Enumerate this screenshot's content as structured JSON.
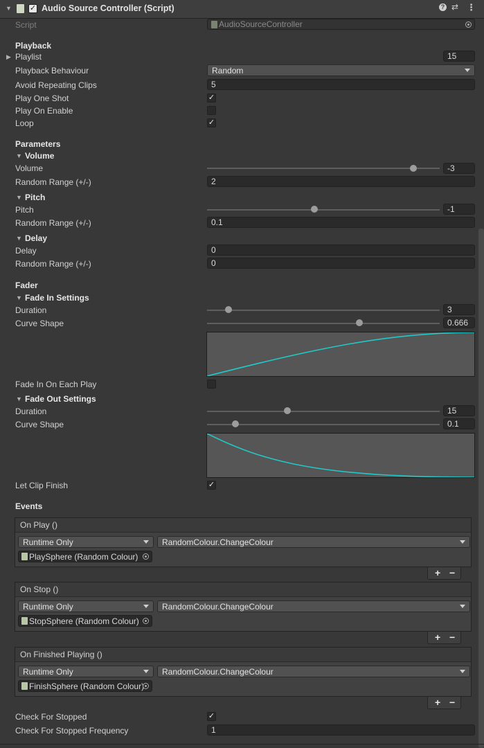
{
  "header": {
    "title": "Audio Source Controller (Script)"
  },
  "script": {
    "label": "Script",
    "value": "AudioSourceController"
  },
  "playback": {
    "section": "Playback",
    "playlist_label": "Playlist",
    "playlist_count": "15",
    "behaviour_label": "Playback Behaviour",
    "behaviour_value": "Random",
    "avoid_label": "Avoid Repeating Clips",
    "avoid_value": "5",
    "one_shot_label": "Play One Shot",
    "one_shot": true,
    "on_enable_label": "Play On Enable",
    "on_enable": false,
    "loop_label": "Loop",
    "loop": true
  },
  "parameters": {
    "section": "Parameters",
    "volume": {
      "group": "Volume",
      "label": "Volume",
      "value": "-3",
      "slider": 0.9,
      "range_label": "Random Range (+/-)",
      "range_value": "2"
    },
    "pitch": {
      "group": "Pitch",
      "label": "Pitch",
      "value": "-1",
      "slider": 0.46,
      "range_label": "Random Range (+/-)",
      "range_value": "0.1"
    },
    "delay": {
      "group": "Delay",
      "label": "Delay",
      "value": "0",
      "range_label": "Random Range (+/-)",
      "range_value": "0"
    }
  },
  "fader": {
    "section": "Fader",
    "fade_in": {
      "group": "Fade In Settings",
      "duration_label": "Duration",
      "duration_value": "3",
      "duration_slider": 0.08,
      "curve_label": "Curve Shape",
      "curve_value": "0.666",
      "curve_slider": 0.66
    },
    "fade_in_each_label": "Fade In On Each Play",
    "fade_in_each": false,
    "fade_out": {
      "group": "Fade Out Settings",
      "duration_label": "Duration",
      "duration_value": "15",
      "duration_slider": 0.34,
      "curve_label": "Curve Shape",
      "curve_value": "0.1",
      "curve_slider": 0.11
    },
    "let_finish_label": "Let Clip Finish",
    "let_finish": true
  },
  "events": {
    "section": "Events",
    "list": [
      {
        "title": "On Play ()",
        "mode": "Runtime Only",
        "function": "RandomColour.ChangeColour",
        "object": "PlaySphere (Random Colour)"
      },
      {
        "title": "On Stop ()",
        "mode": "Runtime Only",
        "function": "RandomColour.ChangeColour",
        "object": "StopSphere (Random Colour)"
      },
      {
        "title": "On Finished Playing ()",
        "mode": "Runtime Only",
        "function": "RandomColour.ChangeColour",
        "object": "FinishSphere (Random Colour)"
      }
    ],
    "plus": "+",
    "minus": "−"
  },
  "check_stopped": {
    "label": "Check For Stopped",
    "value": true,
    "freq_label": "Check For Stopped Frequency",
    "freq_value": "1"
  },
  "colors": {
    "curve": "#21c8c8",
    "background": "#383838"
  }
}
